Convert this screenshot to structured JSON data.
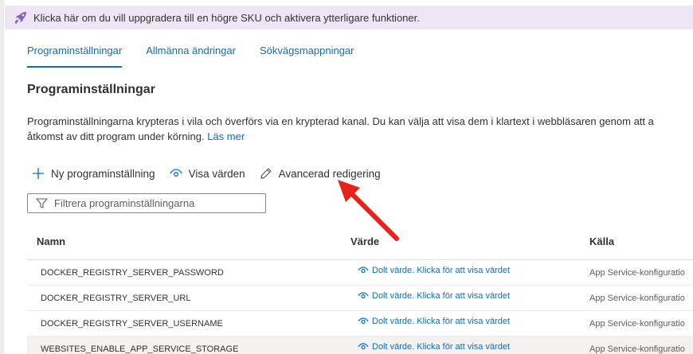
{
  "banner": {
    "icon": "rocket-icon",
    "text": "Klicka här om du vill uppgradera till en högre SKU och aktivera ytterligare funktioner."
  },
  "tabs": [
    {
      "label": "Programinställningar",
      "active": true
    },
    {
      "label": "Allmänna ändringar",
      "active": false
    },
    {
      "label": "Sökvägsmappningar",
      "active": false
    }
  ],
  "section": {
    "title": "Programinställningar",
    "description_line1": "Programinställningarna krypteras i vila och överförs via en krypterad kanal. Du kan välja att visa dem i klartext i webbläsaren genom att a",
    "description_line2": "åtkomst av ditt program under körning.",
    "learn_more": "Läs mer"
  },
  "toolbar": {
    "new_setting": "Ny programinställning",
    "show_values": "Visa värden",
    "advanced_edit": "Avancerad redigering"
  },
  "filter": {
    "placeholder": "Filtrera programinställningarna"
  },
  "table": {
    "columns": {
      "name": "Namn",
      "value": "Värde",
      "source": "Källa"
    },
    "rows": [
      {
        "name": "DOCKER_REGISTRY_SERVER_PASSWORD",
        "value": "Dolt värde. Klicka för att visa värdet",
        "source": "App Service-konfiguratio"
      },
      {
        "name": "DOCKER_REGISTRY_SERVER_URL",
        "value": "Dolt värde. Klicka för att visa värdet",
        "source": "App Service-konfiguratio"
      },
      {
        "name": "DOCKER_REGISTRY_SERVER_USERNAME",
        "value": "Dolt värde. Klicka för att visa värdet",
        "source": "App Service-konfiguratio"
      },
      {
        "name": "WEBSITES_ENABLE_APP_SERVICE_STORAGE",
        "value": "Dolt värde. Klicka för att visa värdet",
        "source": "App Service-konfiguratio"
      }
    ]
  },
  "colors": {
    "accent": "#0f6cbd",
    "banner_bg": "#efe6f5",
    "rocket": "#8661c5",
    "annotation_arrow": "#e8221b"
  }
}
